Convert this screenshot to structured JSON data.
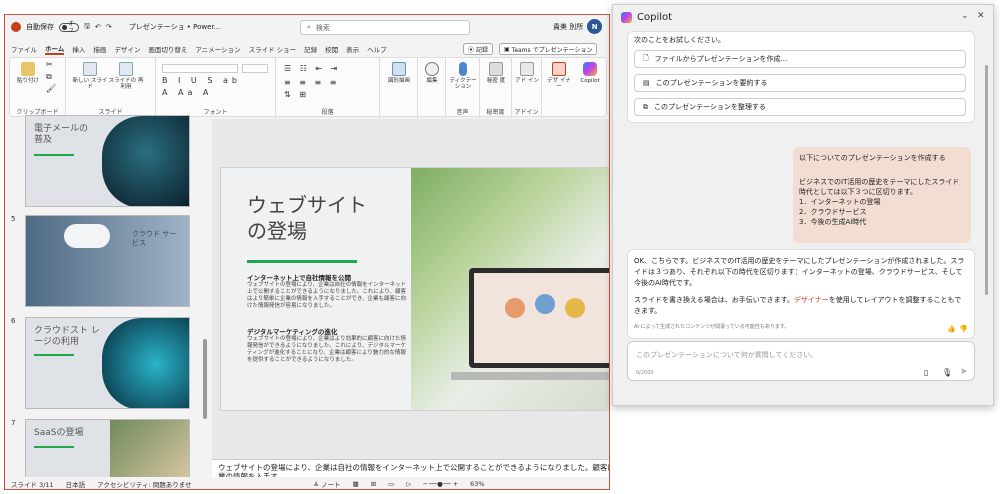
{
  "titlebar": {
    "autosave_label": "自動保存",
    "autosave_state": "オフ",
    "doc_title": "プレゼンテーショ • Power...",
    "search_placeholder": "検索",
    "user_name": "貴美 別所",
    "user_initial": "N"
  },
  "menu": {
    "tabs": [
      "ファイル",
      "ホーム",
      "挿入",
      "描画",
      "デザイン",
      "画面切り替え",
      "アニメーション",
      "スライド ショー",
      "記録",
      "校閲",
      "表示",
      "ヘルプ"
    ],
    "active_tab": "ホーム",
    "record_button": "記録",
    "teams_button": "Teams でプレゼンテーション"
  },
  "ribbon": {
    "clipboard_label": "クリップボード",
    "paste_label": "貼り付け",
    "new_slide_label": "新しい スライド",
    "reuse_slide_label": "スライドの 再利用",
    "slides_label": "スライド",
    "font_label": "フォント",
    "paragraph_label": "段落",
    "shapes_label": "図形描画",
    "editing_label": "編集",
    "dictate_label": "ディクテー ション",
    "voice_label": "音声",
    "sensitivity_btn": "秘密 度",
    "sensitivity_label": "秘密度",
    "addin_btn": "アド イン",
    "addin_label": "アドイン",
    "designer_btn": "デザ イナー",
    "copilot_btn": "Copilot"
  },
  "thumbnails": [
    {
      "number": "",
      "title": "電子メールの 普及"
    },
    {
      "number": "5",
      "title": "クラウド サービス"
    },
    {
      "number": "6",
      "title": "クラウドスト レージの利用"
    },
    {
      "number": "7",
      "title": "SaaSの登場"
    }
  ],
  "slide": {
    "title_line1": "ウェブサイト",
    "title_line2": "の登場",
    "section1_heading": "インターネット上で自社情報を公開",
    "section1_body": "ウェブサイトの登場により、企業は自社の情報をインターネット上で公開することができるようになりました。これにより、顧客はより簡単に企業の情報を入手することができ、企業も顧客に向けた情報発信が容易になりました。",
    "section2_heading": "デジタルマーケティングの進化",
    "section2_body": "ウェブサイトの登場により、企業はより効果的に顧客に向けた情報発信ができるようになりました。これにより、デジタルマーケティングが進化することになり、企業は顧客により魅力的な情報を提供することができるようになりました。"
  },
  "notes": {
    "text": "ウェブサイトの登場により、企業は自社の情報をインターネット上で公開することができるようになりました。顧客はより簡単に企業の情報を入手す"
  },
  "status": {
    "slide_info": "スライド 3/11",
    "language": "日本語",
    "accessibility": "アクセシビリティ: 問題ありませ",
    "notes_label": "ノート",
    "zoom": "63%"
  },
  "copilot": {
    "title": "Copilot",
    "suggest_intro": "次のことをお試しください。",
    "suggestions": [
      "ファイルからプレゼンテーションを作成...",
      "このプレゼンテーションを要約する",
      "このプレゼンテーションを整理する"
    ],
    "user_message_line1": "以下についてのプレゼンテーションを作成する",
    "user_message_line2": "ビジネスでのIT活用の歴史をテーマにしたスライド",
    "user_message_line3": "時代としては以下３つに区切ります。",
    "user_message_items": [
      "1．インターネットの登場",
      "2．クラウドサービス",
      "3．今後の生成AI時代"
    ],
    "bot_message_p1": "OK、こちらです。ビジネスでのIT活用の歴史をテーマにしたプレゼンテーションが作成されました。スライドは３つあり、それぞれ以下の時代を区切ります：インターネットの登場、クラウドサービス、そして今後のAI時代です。",
    "bot_message_p2_pre": "スライドを書き換える場合は、お手伝いできます。",
    "bot_message_p2_link": "デザイナー",
    "bot_message_p2_post": "を使用してレイアウトを調整することもできます。",
    "ai_note": "AI によって生成されたコンテンツが間違っている可能性もあります。",
    "input_placeholder": "このプレゼンテーションについて何か質問してください。",
    "char_count": "0/2000"
  }
}
